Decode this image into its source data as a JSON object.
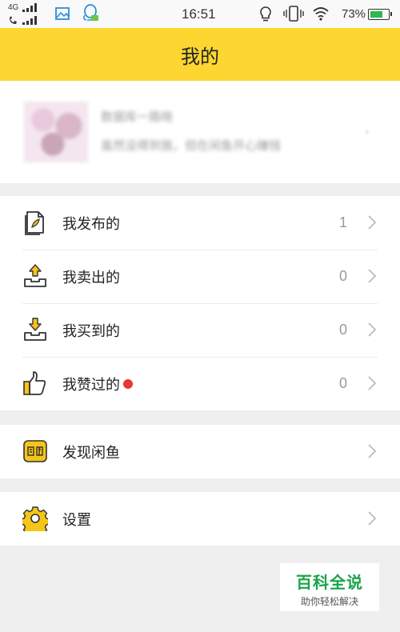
{
  "status_bar": {
    "network_top": "4G",
    "time": "16:51",
    "battery_percent": "73%",
    "battery_level": 0.73,
    "icons": [
      "signal-4g-icon",
      "call-signal-icon",
      "gallery-icon",
      "qq-icon",
      "bulb-icon",
      "vibrate-icon",
      "wifi-icon",
      "battery-icon"
    ]
  },
  "header": {
    "title": "我的"
  },
  "profile": {
    "name": "数据库一路晓",
    "bio": "虽然没得到我，但在闲鱼开心赚钱"
  },
  "menu_group_1": [
    {
      "label": "我发布的",
      "count": "1",
      "icon": "publish-doc-icon"
    },
    {
      "label": "我卖出的",
      "count": "0",
      "icon": "sold-tray-icon"
    },
    {
      "label": "我买到的",
      "count": "0",
      "icon": "bought-tray-icon"
    },
    {
      "label": "我赞过的",
      "count": "0",
      "icon": "thumbs-up-icon",
      "badge": true
    }
  ],
  "menu_group_2": [
    {
      "label": "发现闲鱼",
      "icon": "xianyu-logo-icon"
    }
  ],
  "menu_group_3": [
    {
      "label": "设置",
      "icon": "gear-icon"
    }
  ],
  "watermark": {
    "line1": "百科全说",
    "line2": "助你轻松解决"
  },
  "colors": {
    "header_yellow": "#fdd631",
    "badge_red": "#e23a3a",
    "battery_green": "#2db84d",
    "watermark_green": "#1aa34a"
  }
}
